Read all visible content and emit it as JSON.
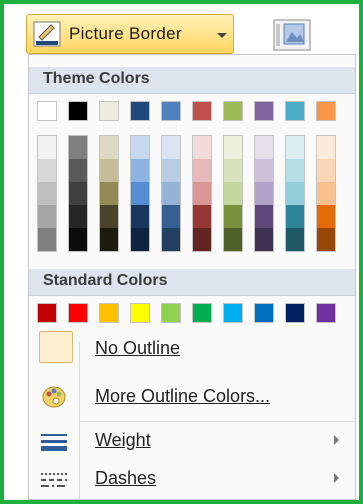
{
  "toolbar": {
    "picture_border_label": "Picture Border",
    "icons": [
      "pen-line-icon",
      "dropdown-arrow-icon",
      "picture-icon"
    ]
  },
  "menu": {
    "theme_colors_label": "Theme Colors",
    "standard_colors_label": "Standard Colors",
    "theme_top_row": [
      "#ffffff",
      "#000000",
      "#eeece1",
      "#1f497d",
      "#4f81bd",
      "#c0504d",
      "#9bbb59",
      "#8064a2",
      "#4bacc6",
      "#f79646"
    ],
    "theme_shades": [
      [
        "#f2f2f2",
        "#d8d8d8",
        "#bfbfbf",
        "#a5a5a5",
        "#7f7f7f"
      ],
      [
        "#7f7f7f",
        "#595959",
        "#3f3f3f",
        "#262626",
        "#0c0c0c"
      ],
      [
        "#ddd9c3",
        "#c4bd97",
        "#938953",
        "#494429",
        "#1d1b10"
      ],
      [
        "#c6d9f0",
        "#8db3e2",
        "#548dd4",
        "#17365d",
        "#0f243e"
      ],
      [
        "#dbe5f1",
        "#b8cce4",
        "#95b3d7",
        "#366092",
        "#244061"
      ],
      [
        "#f2dcdb",
        "#e5b9b7",
        "#d99694",
        "#953734",
        "#632423"
      ],
      [
        "#ebf1dd",
        "#d7e3bc",
        "#c3d69b",
        "#76923c",
        "#4f6128"
      ],
      [
        "#e5e0ec",
        "#ccc1d9",
        "#b2a2c7",
        "#5f497a",
        "#3f3151"
      ],
      [
        "#dbeef3",
        "#b7dde8",
        "#92cddc",
        "#31859b",
        "#205867"
      ],
      [
        "#fdeada",
        "#fbd5b5",
        "#fac08f",
        "#e36c09",
        "#974806"
      ]
    ],
    "standard_colors": [
      "#c00000",
      "#ff0000",
      "#ffc000",
      "#ffff00",
      "#92d050",
      "#00b050",
      "#00b0f0",
      "#0070c0",
      "#002060",
      "#7030a0"
    ],
    "no_outline_label": "No Outline",
    "more_colors_label": "More Outline Colors...",
    "weight_label": "Weight",
    "dashes_label": "Dashes"
  },
  "colors": {
    "frame_green": "#1fb03f",
    "button_highlight": "#ffd561",
    "header_bg": "#dde4ee"
  }
}
